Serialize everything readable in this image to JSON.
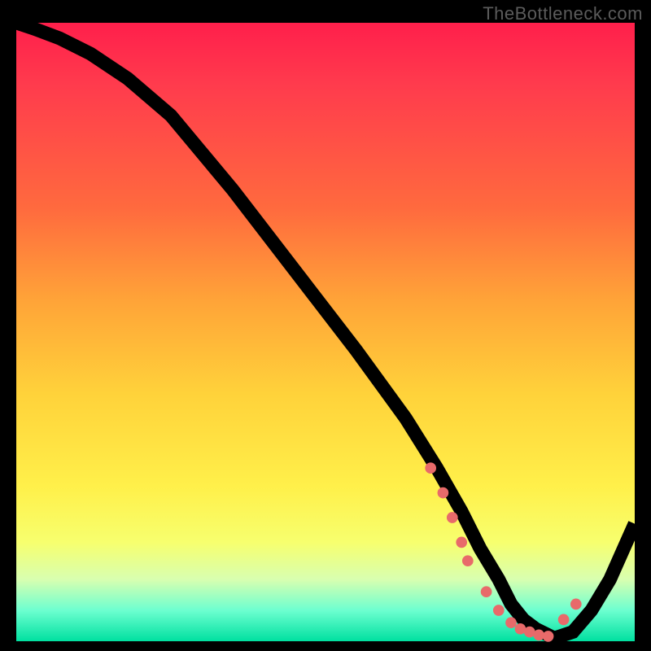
{
  "watermark": "TheBottleneck.com",
  "chart_data": {
    "type": "line",
    "title": "",
    "xlabel": "",
    "ylabel": "",
    "xlim": [
      0,
      100
    ],
    "ylim": [
      0,
      100
    ],
    "series": [
      {
        "name": "curve",
        "x": [
          0,
          3,
          7,
          12,
          18,
          25,
          35,
          45,
          55,
          63,
          68,
          72,
          75,
          78,
          80,
          82,
          84,
          86,
          87,
          90,
          93,
          96,
          100
        ],
        "y": [
          100,
          99,
          97.5,
          95,
          91,
          85,
          73,
          60,
          47,
          36,
          28,
          21,
          15,
          10,
          6,
          3.5,
          2,
          1,
          0.5,
          1.5,
          5,
          10,
          19
        ]
      }
    ],
    "markers": {
      "name": "highlight-dots",
      "color": "#e86a6a",
      "x": [
        67,
        69,
        70.5,
        72,
        73,
        76,
        78,
        80,
        81.5,
        83,
        84.5,
        86,
        88.5,
        90.5
      ],
      "y": [
        28,
        24,
        20,
        16,
        13,
        8,
        5,
        3,
        2,
        1.5,
        1,
        0.8,
        3.5,
        6
      ]
    }
  }
}
